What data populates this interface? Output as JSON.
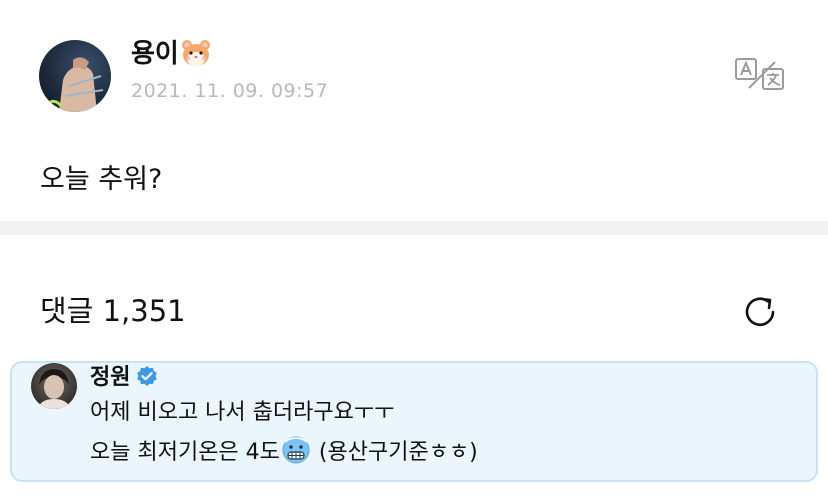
{
  "post": {
    "author": "용이",
    "author_emoji": "hamster-face-icon",
    "timestamp": "2021. 11. 09. 09:57",
    "body": "오늘 추워?"
  },
  "toolbar": {
    "translate_icon": "translate-icon"
  },
  "comments": {
    "header": "댓글 1,351",
    "refresh_icon": "refresh-icon",
    "highlight_color": "#eaf6fc",
    "items": [
      {
        "author": "정원",
        "verified": true,
        "verified_color": "#3b9ae1",
        "line1": "어제 비오고 나서 춥더라구요ㅜㅜ",
        "line2_before": "오늘 최저기온은 4도",
        "line2_emoji": "cold-face-icon",
        "line2_after": "(용산구기준ㅎㅎ)"
      }
    ]
  }
}
